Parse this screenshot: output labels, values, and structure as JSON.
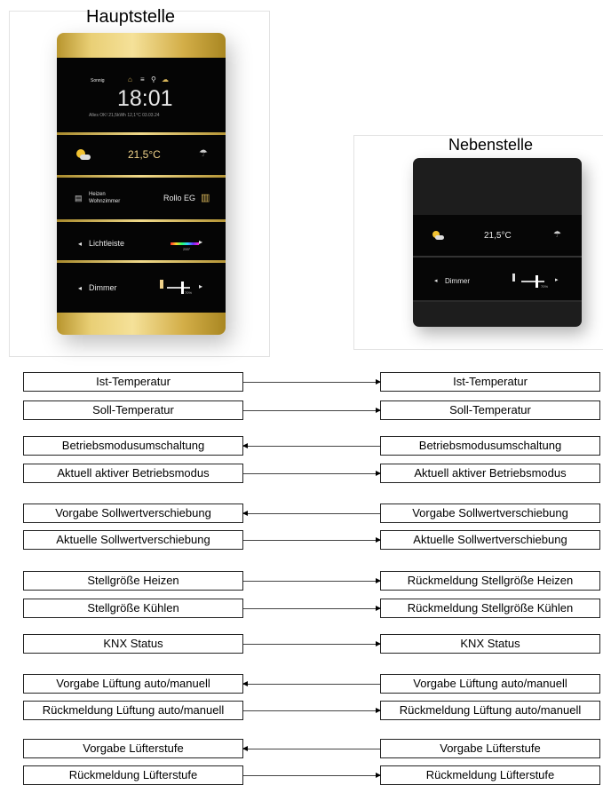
{
  "titles": {
    "main": "Hauptstelle",
    "second": "Nebenstelle"
  },
  "main_device": {
    "weather": "Sonnig",
    "time": "18:01",
    "status_line": "Alles OK!  21,5kWh   12,1°C   03.03.24",
    "temperature": "21,5°C",
    "heat_label_1": "Heizen",
    "heat_label_2": "Wohnzimmer",
    "blind_label": "Rollo EG",
    "light_label": "Lichtleiste",
    "light_value": "255°",
    "dimmer_label": "Dimmer",
    "dimmer_value": "70%",
    "left_arrow_glyph": "◂",
    "right_arrow_glyph": "▸"
  },
  "second_device": {
    "temperature": "21,5°C",
    "dimmer_label": "Dimmer",
    "dimmer_value": "70%",
    "left_arrow_glyph": "◂",
    "right_arrow_glyph": "▸"
  },
  "diagram": {
    "rows": [
      {
        "left": "Ist-Temperatur",
        "right": "Ist-Temperatur",
        "direction": "right"
      },
      {
        "left": "Soll-Temperatur",
        "right": "Soll-Temperatur",
        "direction": "right"
      },
      {
        "left": "Betriebsmodusumschaltung",
        "right": "Betriebsmodusumschaltung",
        "direction": "left"
      },
      {
        "left": "Aktuell aktiver Betriebsmodus",
        "right": "Aktuell aktiver Betriebsmodus",
        "direction": "right"
      },
      {
        "left": "Vorgabe Sollwertverschiebung",
        "right": "Vorgabe Sollwertverschiebung",
        "direction": "left"
      },
      {
        "left": "Aktuelle Sollwertverschiebung",
        "right": "Aktuelle Sollwertverschiebung",
        "direction": "right"
      },
      {
        "left": "Stellgröße Heizen",
        "right": "Rückmeldung Stellgröße Heizen",
        "direction": "right"
      },
      {
        "left": "Stellgröße Kühlen",
        "right": "Rückmeldung Stellgröße Kühlen",
        "direction": "right"
      },
      {
        "left": "KNX Status",
        "right": "KNX Status",
        "direction": "right"
      },
      {
        "left": "Vorgabe Lüftung auto/manuell",
        "right": "Vorgabe Lüftung auto/manuell",
        "direction": "left"
      },
      {
        "left": "Rückmeldung Lüftung auto/manuell",
        "right": "Rückmeldung Lüftung auto/manuell",
        "direction": "right"
      },
      {
        "left": "Vorgabe Lüfterstufe",
        "right": "Vorgabe Lüfterstufe",
        "direction": "left"
      },
      {
        "left": "Rückmeldung Lüfterstufe",
        "right": "Rückmeldung Lüfterstufe",
        "direction": "right"
      }
    ]
  }
}
